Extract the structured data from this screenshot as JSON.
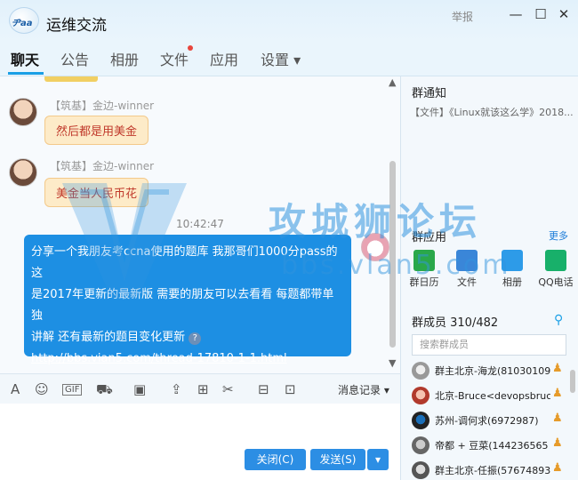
{
  "window": {
    "logo_text": "ヂaa",
    "title": "运维交流",
    "report": "举报",
    "minimize": "—",
    "maximize": "☐",
    "close": "✕"
  },
  "tabs": [
    {
      "label": "聊天",
      "active": true
    },
    {
      "label": "公告"
    },
    {
      "label": "相册"
    },
    {
      "label": "文件"
    },
    {
      "label": "应用"
    },
    {
      "label": "设置 ▾"
    }
  ],
  "chat": {
    "messages": [
      {
        "sender": "【筑基】金边-winner",
        "text": "然后都是用美金"
      },
      {
        "sender": "【筑基】金边-winner",
        "text": "美金当人民币花"
      }
    ],
    "timestamp": "10:42:47",
    "shared": {
      "line1": "分享一个我朋友考ccna使用的题库 我那哥们1000分pass的 这",
      "line2": "是2017年更新的最新版 需要的朋友可以去看看 每题都带单独",
      "line3": "讲解 还有最新的题目变化更新",
      "qmark": "?",
      "link": "http://bbs.vian5.com/thread-17810-1-1.html"
    }
  },
  "watermark": {
    "title": "攻城狮论坛",
    "url": "bbs.vlan5.com"
  },
  "toolbar": {
    "icons": [
      "font-icon",
      "emoji-icon",
      "gif-icon",
      "screenshot-icon",
      "image-icon",
      "upload-icon",
      "gift-icon",
      "scissors-icon",
      "red-packet-icon",
      "screen-share-icon"
    ],
    "gif_label": "GIF",
    "message_record": "消息记录 ▾"
  },
  "actions": {
    "close": "关闭(C)",
    "send": "发送(S)",
    "send_dropdown": "▾"
  },
  "side": {
    "notice_title": "群通知",
    "notice_text": "【文件】《Linux就该这么学》2018...",
    "apps_title": "群应用",
    "more": "更多",
    "apps": [
      {
        "label": "群日历",
        "color": "#2aa84a"
      },
      {
        "label": "文件",
        "color": "#3a86d8"
      },
      {
        "label": "相册",
        "color": "#2d9be8"
      },
      {
        "label": "QQ电话",
        "color": "#18b06a"
      }
    ],
    "members_title": "群成员 310/482",
    "search_placeholder": "搜索群成员",
    "members": [
      {
        "name": "群主北京-海龙(81030109"
      },
      {
        "name": "北京-Bruce<devopsbruce"
      },
      {
        "name": "苏州-调何求(6972987)"
      },
      {
        "name": "帝都 + 豆菜(144236565"
      },
      {
        "name": "群主北京-任振(57674893"
      }
    ]
  }
}
